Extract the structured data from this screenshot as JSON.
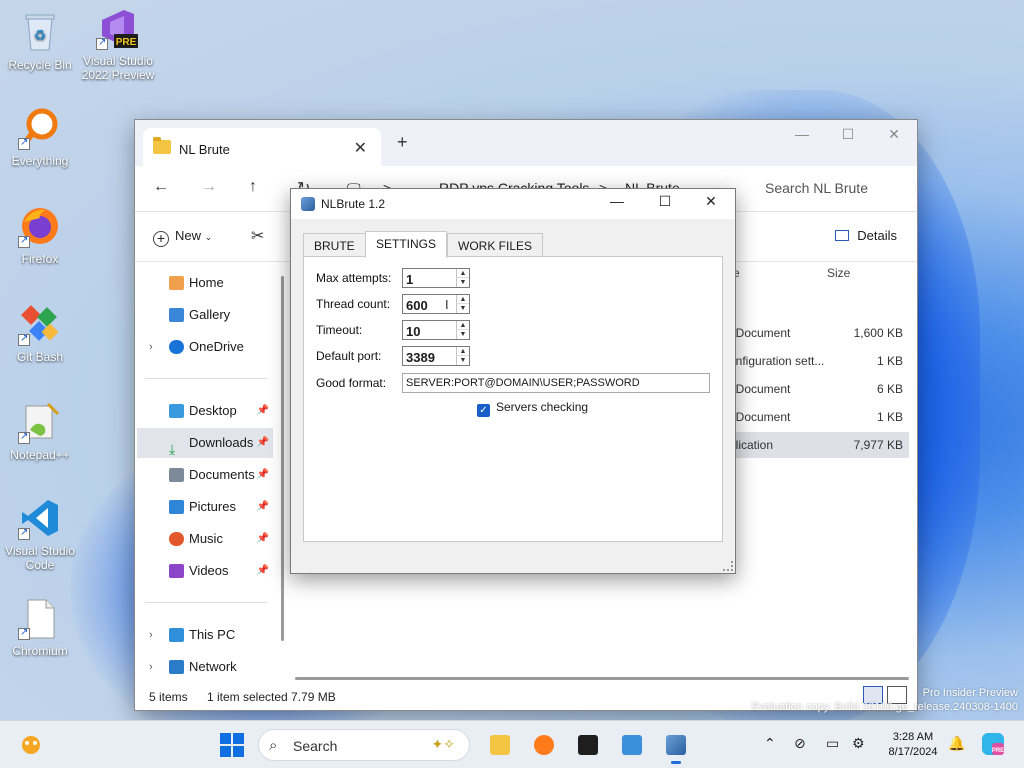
{
  "desktop": {
    "icons": [
      {
        "label": "Recycle Bin",
        "icon": "recycle-bin-icon"
      },
      {
        "label": "Visual Studio 2022 Preview",
        "badge": "PRE",
        "icon": "visual-studio-icon"
      },
      {
        "label": "Everything",
        "icon": "everything-search-icon"
      },
      {
        "label": "Firefox",
        "icon": "firefox-icon"
      },
      {
        "label": "Git Bash",
        "icon": "git-bash-icon"
      },
      {
        "label": "Notepad++",
        "icon": "notepad-plus-plus-icon"
      },
      {
        "label": "Visual Studio Code",
        "icon": "vscode-icon"
      },
      {
        "label": "Chromium",
        "icon": "file-icon"
      }
    ],
    "watermark_line1": "Pro Insider Preview",
    "watermark_line2": "Evaluation copy. Build 26100.ge_release.240308-1400"
  },
  "explorer": {
    "tab_title": "NL Brute",
    "new_tab": "+",
    "breadcrumb": [
      "···",
      "RDP vps Cracking Tools",
      "NL Brute"
    ],
    "breadcrumb_sep": ">",
    "search_placeholder": "Search NL Brute",
    "new_label": "New",
    "details_label": "Details",
    "sidebar": {
      "home": "Home",
      "gallery": "Gallery",
      "onedrive": "OneDrive",
      "desktop": "Desktop",
      "downloads": "Downloads",
      "documents": "Documents",
      "pictures": "Pictures",
      "music": "Music",
      "videos": "Videos",
      "this_pc": "This PC",
      "network": "Network"
    },
    "columns": {
      "type": "e",
      "size": "Size"
    },
    "rows": [
      {
        "type": "t Document",
        "size": "1,600 KB"
      },
      {
        "type": "onfiguration sett...",
        "size": "1 KB"
      },
      {
        "type": "t Document",
        "size": "6 KB"
      },
      {
        "type": "t Document",
        "size": "1 KB"
      },
      {
        "type": "plication",
        "size": "7,977 KB"
      }
    ],
    "status": {
      "items": "5 items",
      "selected": "1 item selected  7.79 MB"
    }
  },
  "dialog": {
    "title": "NLBrute 1.2",
    "tabs": [
      "BRUTE",
      "SETTINGS",
      "WORK FILES"
    ],
    "active_tab": "SETTINGS",
    "fields": {
      "max_attempts_label": "Max attempts:",
      "max_attempts_value": "1",
      "thread_count_label": "Thread count:",
      "thread_count_value": "600",
      "timeout_label": "Timeout:",
      "timeout_value": "10",
      "default_port_label": "Default port:",
      "default_port_value": "3389",
      "good_format_label": "Good format:",
      "good_format_value": "SERVER:PORT@DOMAIN\\USER;PASSWORD",
      "servers_checking_label": "Servers checking",
      "servers_checking_checked": true
    }
  },
  "taskbar": {
    "search_placeholder": "Search",
    "time": "3:28 AM",
    "date": "8/17/2024"
  },
  "colors": {
    "accent": "#0f6fe0",
    "checkbox": "#1a5fc7",
    "folder": "#f4c542"
  }
}
